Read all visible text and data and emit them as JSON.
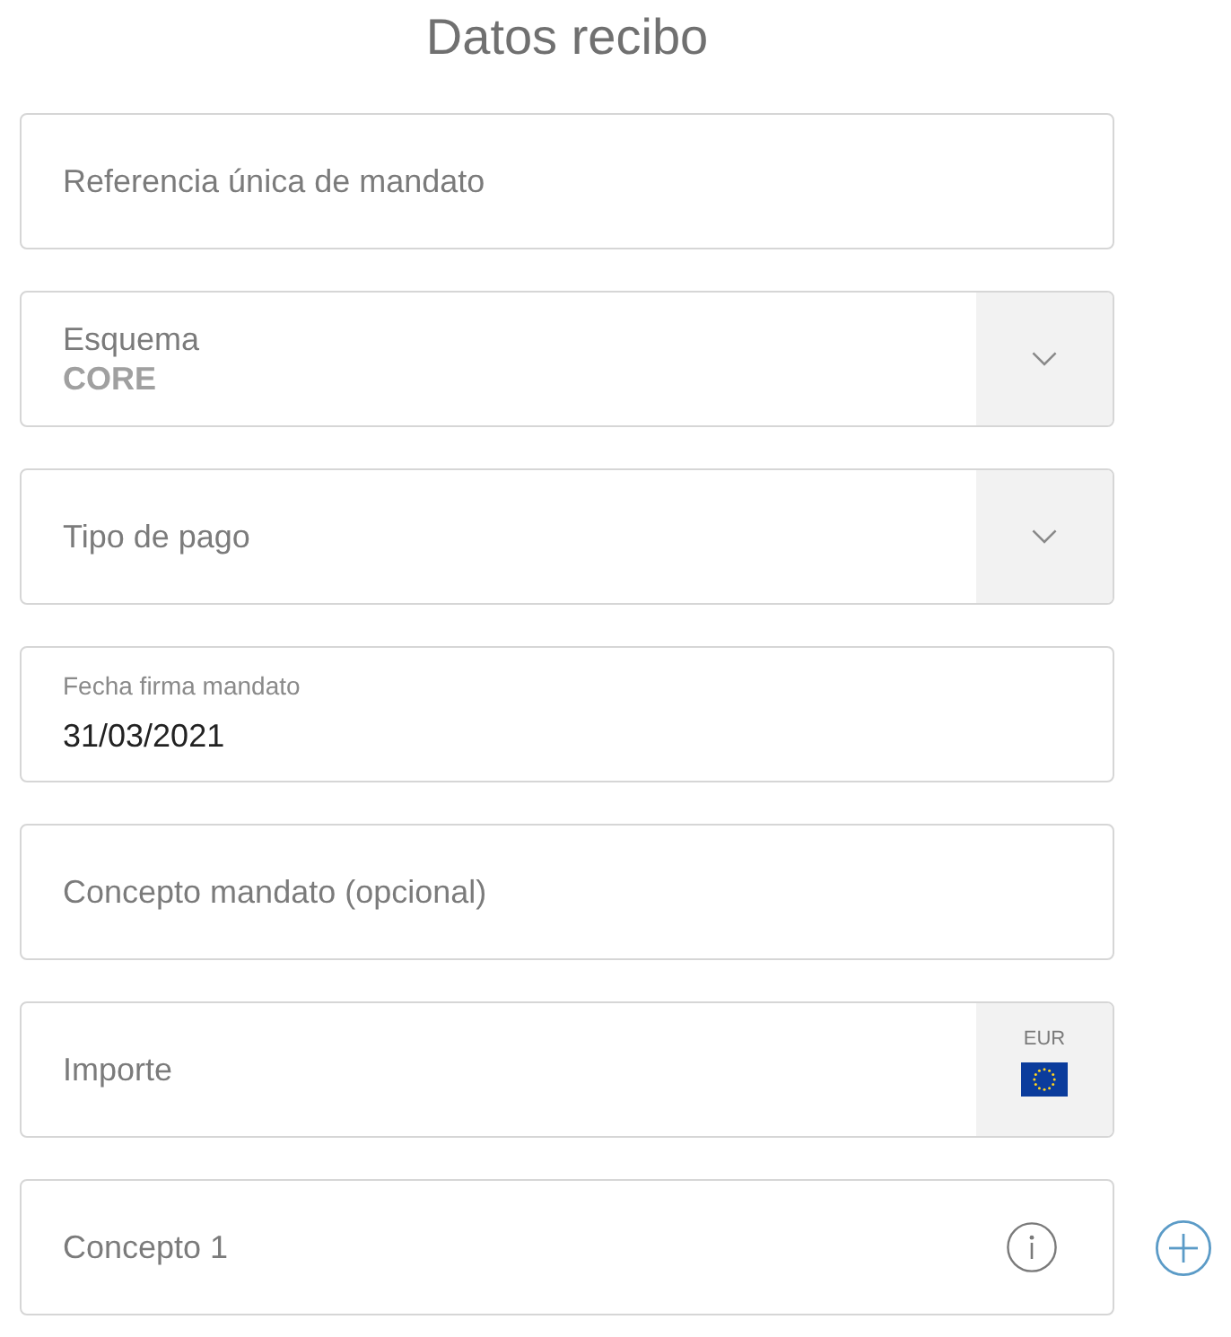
{
  "title": "Datos recibo",
  "fields": [
    {
      "kind": "text",
      "placeholder": "Referencia única de mandato"
    },
    {
      "kind": "select",
      "label": "Esquema",
      "value": "CORE"
    },
    {
      "kind": "select",
      "placeholder": "Tipo de pago"
    },
    {
      "kind": "date",
      "label": "Fecha firma mandato",
      "value": "31/03/2021"
    },
    {
      "kind": "text",
      "placeholder": "Concepto mandato (opcional)"
    },
    {
      "kind": "currency",
      "placeholder": "Importe",
      "currency": "EUR"
    },
    {
      "kind": "concept",
      "placeholder": "Concepto 1"
    }
  ]
}
